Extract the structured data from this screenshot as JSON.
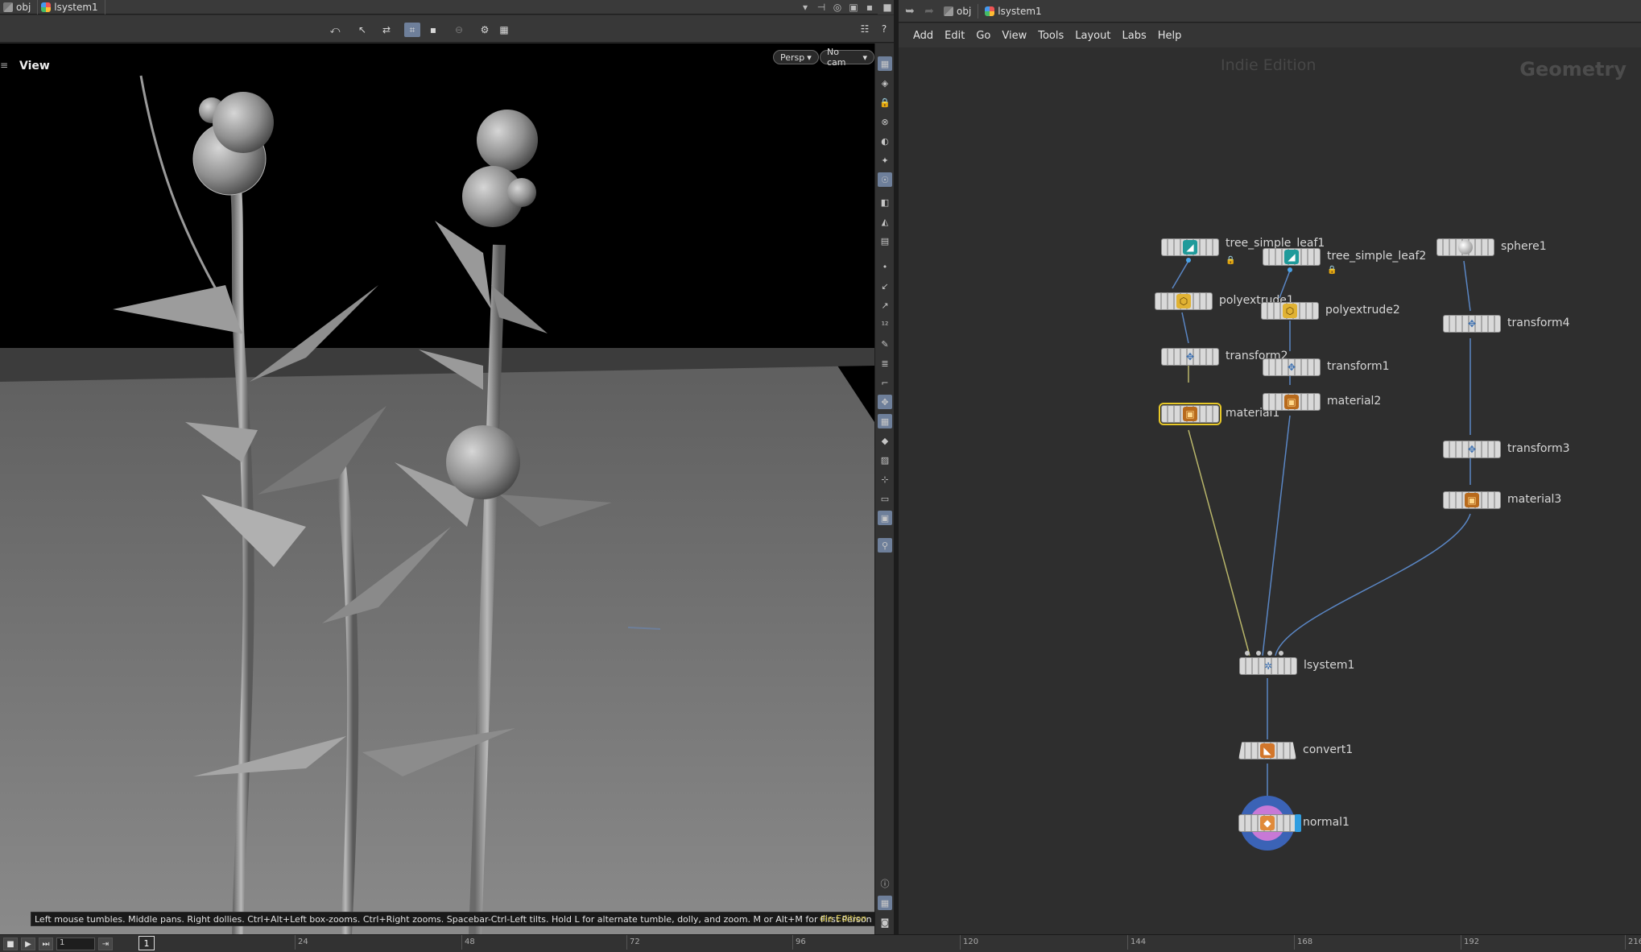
{
  "left_pane": {
    "path": {
      "root": "obj",
      "node": "lsystem1"
    },
    "viewport": {
      "title": "View",
      "persp_label": "Persp",
      "cam_label": "No cam",
      "hint": "Left mouse tumbles. Middle pans. Right dollies. Ctrl+Alt+Left box-zooms. Ctrl+Right zooms. Spacebar-Ctrl-Left tilts. Hold L for alternate tumble, dolly, and zoom. M or Alt+M for First Person Navigation.",
      "edition": "die Edition"
    },
    "toolbar_icons": [
      "tumble-icon",
      "select-icon",
      "transform-icon",
      "snap-icon",
      "display-icon",
      "disabled-icon",
      "camera-icon",
      "render-icon"
    ]
  },
  "right_pane": {
    "path": {
      "root": "obj",
      "node": "lsystem1"
    },
    "menu": [
      "Add",
      "Edit",
      "Go",
      "View",
      "Tools",
      "Layout",
      "Labs",
      "Help"
    ],
    "watermark": "Indie Edition",
    "context": "Geometry",
    "nodes": {
      "tree_simple_leaf1": "tree_simple_leaf1",
      "tree_simple_leaf2": "tree_simple_leaf2",
      "sphere1": "sphere1",
      "polyextrude1": "polyextrude1",
      "polyextrude2": "polyextrude2",
      "transform4": "transform4",
      "transform2": "transform2",
      "transform1": "transform1",
      "material1": "material1",
      "material2": "material2",
      "transform3": "transform3",
      "material3": "material3",
      "lsystem1": "lsystem1",
      "convert1": "convert1",
      "normal1": "normal1"
    }
  },
  "timeline": {
    "frame_field": "1",
    "current_frame": "1",
    "ticks": [
      "24",
      "48",
      "72",
      "96",
      "120",
      "144",
      "168",
      "192",
      "216"
    ]
  },
  "colors": {
    "selected_outline": "#e7c829",
    "wire_blue": "#5a86c4",
    "wire_yellow": "#b8b56a",
    "display_flag": "#2f9de0",
    "toggle_active": "#6e7f9a"
  }
}
